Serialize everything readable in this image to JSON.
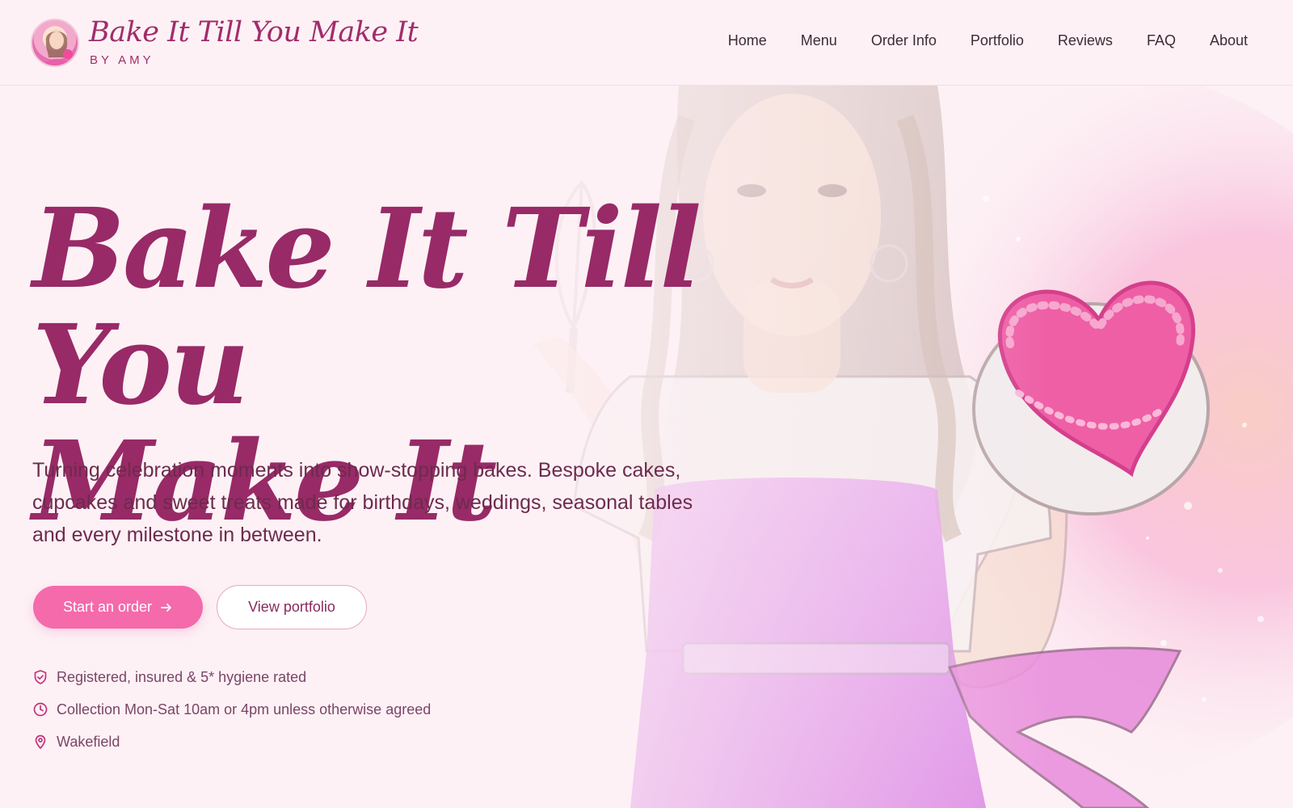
{
  "brand": {
    "title": "Bake It Till You Make It",
    "subtitle": "BY AMY",
    "accent_color": "#982a67",
    "button_color": "#f46aab",
    "background_color": "#fdf1f5"
  },
  "nav": {
    "items": [
      "Home",
      "Menu",
      "Order Info",
      "Portfolio",
      "Reviews",
      "FAQ",
      "About"
    ]
  },
  "hero": {
    "title_line1": "Bake It Till You",
    "title_line2": "Make It",
    "description": "Turning celebration moments into show-stopping bakes. Bespoke cakes, cupcakes and sweet treats made for birthdays, weddings, seasonal tables and every milestone in between.",
    "primary_button": "Start an order",
    "primary_button_icon": "arrow-right-icon",
    "secondary_button": "View portfolio",
    "features": [
      {
        "icon": "shield-check-icon",
        "text": "Registered, insured & 5* hygiene rated"
      },
      {
        "icon": "clock-icon",
        "text": "Collection Mon-Sat 10am or 4pm unless otherwise agreed"
      },
      {
        "icon": "map-pin-icon",
        "text": "Wakefield"
      }
    ]
  }
}
